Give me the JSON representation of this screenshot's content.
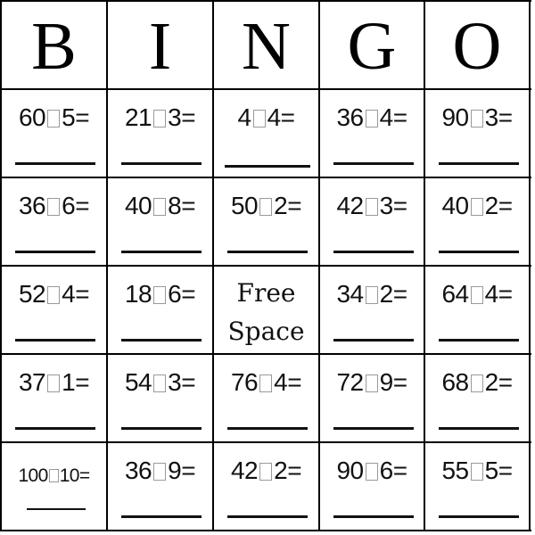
{
  "headers": [
    "B",
    "I",
    "N",
    "G",
    "O"
  ],
  "operator_glyph": "missing-glyph-box",
  "free_space": [
    "Free",
    "Space"
  ],
  "rows": [
    [
      {
        "a": "60",
        "b": "5"
      },
      {
        "a": "21",
        "b": "3"
      },
      {
        "a": "4",
        "b": "4"
      },
      {
        "a": "36",
        "b": "4"
      },
      {
        "a": "90",
        "b": "3"
      }
    ],
    [
      {
        "a": "36",
        "b": "6"
      },
      {
        "a": "40",
        "b": "8"
      },
      {
        "a": "50",
        "b": "2"
      },
      {
        "a": "42",
        "b": "3"
      },
      {
        "a": "40",
        "b": "2"
      }
    ],
    [
      {
        "a": "52",
        "b": "4"
      },
      {
        "a": "18",
        "b": "6"
      },
      {
        "free": true
      },
      {
        "a": "34",
        "b": "2"
      },
      {
        "a": "64",
        "b": "4"
      }
    ],
    [
      {
        "a": "37",
        "b": "1"
      },
      {
        "a": "54",
        "b": "3"
      },
      {
        "a": "76",
        "b": "4"
      },
      {
        "a": "72",
        "b": "9"
      },
      {
        "a": "68",
        "b": "2"
      }
    ],
    [
      {
        "a": "100",
        "b": "10"
      },
      {
        "a": "36",
        "b": "9"
      },
      {
        "a": "42",
        "b": "2"
      },
      {
        "a": "90",
        "b": "6"
      },
      {
        "a": "55",
        "b": "5"
      }
    ]
  ],
  "equals": "=",
  "colors": {
    "grid": "#000000",
    "text": "#111111",
    "operator_box": "#9a9a9a",
    "background": "#ffffff"
  }
}
